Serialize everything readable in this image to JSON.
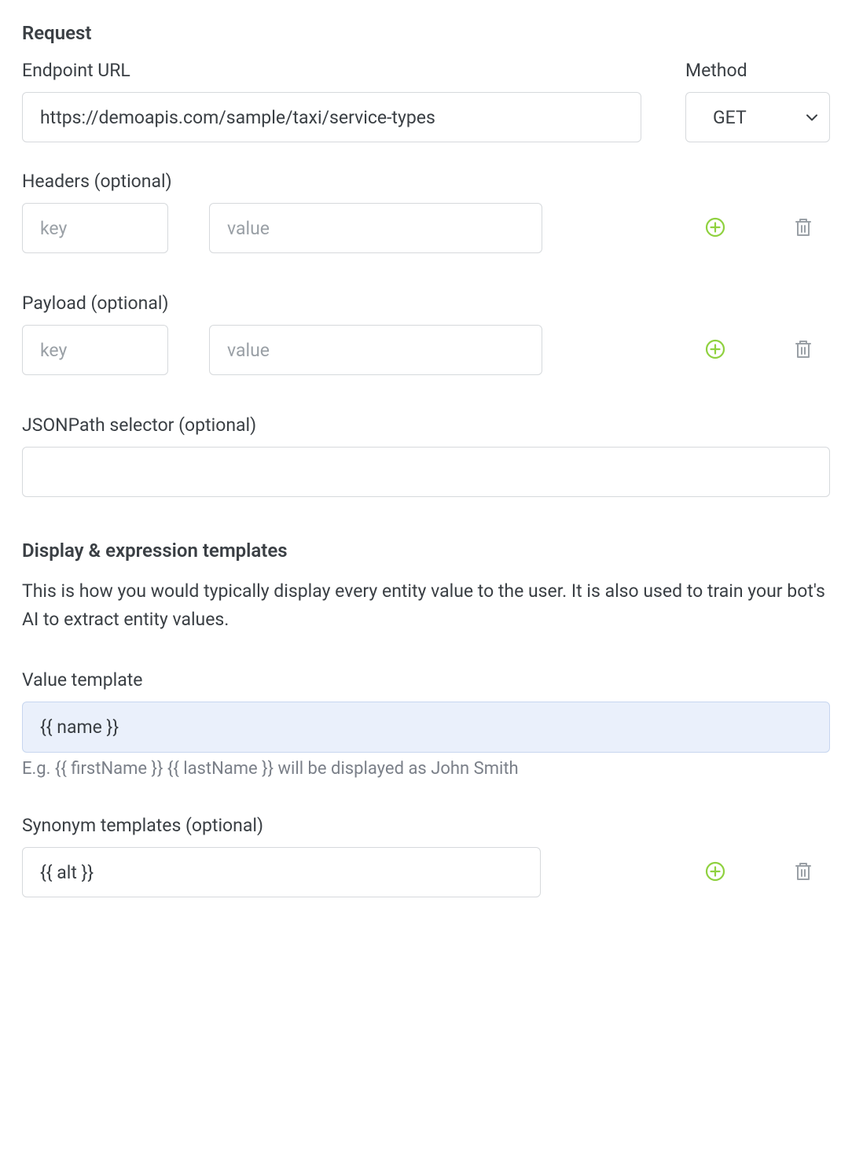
{
  "request": {
    "heading": "Request",
    "endpoint_label": "Endpoint URL",
    "endpoint_value": "https://demoapis.com/sample/taxi/service-types",
    "method_label": "Method",
    "method_value": "GET",
    "headers_label": "Headers (optional)",
    "headers_key_placeholder": "key",
    "headers_value_placeholder": "value",
    "payload_label": "Payload (optional)",
    "payload_key_placeholder": "key",
    "payload_value_placeholder": "value",
    "jsonpath_label": "JSONPath selector (optional)",
    "jsonpath_value": ""
  },
  "templates": {
    "heading": "Display & expression templates",
    "description": "This is how you would typically display every entity value to the user. It is also used to train your bot's AI to extract entity values.",
    "value_template_label": "Value template",
    "value_template_value": "{{ name }}",
    "value_template_hint": "E.g. {{ firstName }} {{ lastName }} will be displayed as John Smith",
    "synonym_label": "Synonym templates (optional)",
    "synonym_value": "{{ alt }}"
  },
  "colors": {
    "accent_green": "#8fd13f",
    "icon_gray": "#9aa0a6"
  }
}
